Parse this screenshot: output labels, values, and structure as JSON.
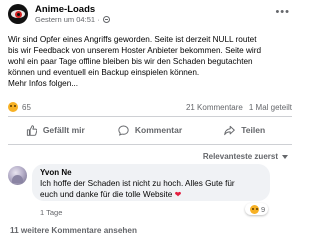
{
  "post": {
    "page_name": "Anime-Loads",
    "timestamp": "Gestern um 04:51 ·",
    "text_lines": [
      "Wir sind Opfer eines Angriffs geworden. Seite ist derzeit NULL routet",
      "bis wir Feedback von unserem Hoster Anbieter bekommen. Seite wird",
      "wohl ein paar Tage offline bleiben bis wir den Schaden begutachten",
      "können und eventuell ein Backup einspielen können.",
      "Mehr Infos folgen..."
    ],
    "reaction_count": "65",
    "comment_count": "21 Kommentare",
    "share_count": "1 Mal geteilt"
  },
  "actions": {
    "like": "Gefällt mir",
    "comment": "Kommentar",
    "share": "Teilen"
  },
  "comments": {
    "sort_label": "Relevanteste zuerst",
    "items": [
      {
        "author": "Yvon Ne",
        "text_line1": "Ich hoffe der Schaden ist nicht zu hoch. Alles Gute für",
        "text_line2": "euch und danke für die tolle Website",
        "time": "1 Tage",
        "reaction_count": "9"
      }
    ],
    "more_link": "11 weitere Kommentare ansehen"
  },
  "icons": {
    "reaction": "sad-face-reaction-icon",
    "like": "thumbs-up-icon",
    "comment": "speech-bubble-icon",
    "share": "share-arrow-icon",
    "more": "more-dots-icon",
    "privacy": "globe-icon",
    "heart": "red-heart-emoji"
  }
}
